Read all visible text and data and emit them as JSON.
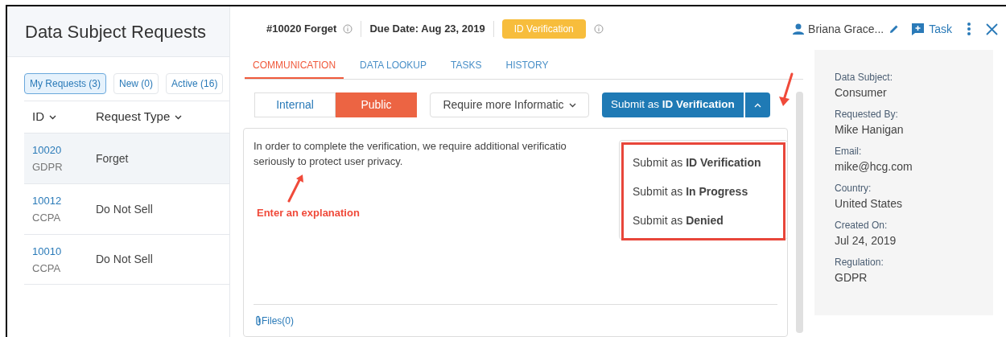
{
  "sidebar": {
    "title": "Data Subject Requests",
    "filters": [
      {
        "label": "My Requests (3)",
        "selected": true
      },
      {
        "label": "New (0)",
        "selected": false
      },
      {
        "label": "Active (16)",
        "selected": false
      }
    ],
    "columns": [
      "ID",
      "Request Type"
    ],
    "rows": [
      {
        "id": "10020",
        "regulation": "GDPR",
        "type": "Forget",
        "selected": true
      },
      {
        "id": "10012",
        "regulation": "CCPA",
        "type": "Do Not Sell",
        "selected": false
      },
      {
        "id": "10010",
        "regulation": "CCPA",
        "type": "Do Not Sell",
        "selected": false
      }
    ]
  },
  "header": {
    "request": "#10020 Forget",
    "due": "Due Date: Aug 23, 2019",
    "status": "ID Verification",
    "assignee": "Briana Grace...",
    "task": "Task"
  },
  "tabs": [
    {
      "label": "COMMUNICATION",
      "selected": true
    },
    {
      "label": "DATA LOOKUP",
      "selected": false
    },
    {
      "label": "TASKS",
      "selected": false
    },
    {
      "label": "HISTORY",
      "selected": false
    }
  ],
  "visibility": [
    {
      "label": "Internal",
      "selected": false
    },
    {
      "label": "Public",
      "selected": true
    }
  ],
  "template": "Require more Informatic",
  "submit": "Submit as **ID Verification**",
  "submit_menu": {
    "expanded": true,
    "items": [
      "Submit as **ID Verification**",
      "Submit as **In Progress**",
      "Submit as **Denied**"
    ]
  },
  "message": {
    "lines": [
      "In order to complete the verification, we require additional verificatio",
      "seriously to protect user privacy."
    ],
    "files": "Files(0)"
  },
  "annotation": "Enter an explanation",
  "details": [
    {
      "label": "Data Subject:",
      "value": "Consumer"
    },
    {
      "label": "Requested By:",
      "value": "Mike Hanigan"
    },
    {
      "label": "Email:",
      "value": "mike@hcg.com"
    },
    {
      "label": "Country:",
      "value": "United States"
    },
    {
      "label": "Created On:",
      "value": "Jul 24, 2019"
    },
    {
      "label": "Regulation:",
      "value": "GDPR"
    }
  ]
}
